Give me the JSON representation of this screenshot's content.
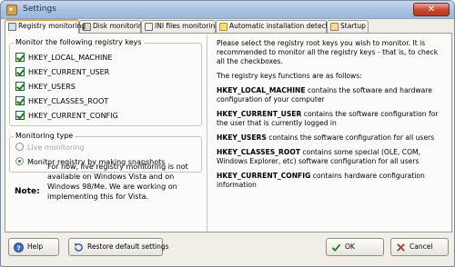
{
  "window": {
    "title": "Settings"
  },
  "tabs": [
    {
      "label": "Registry monitoring",
      "icon": "registry-icon",
      "active": true
    },
    {
      "label": "Disk monitoring",
      "icon": "disk-icon",
      "active": false
    },
    {
      "label": "INI files monitoring",
      "icon": "ini-file-icon",
      "active": false
    },
    {
      "label": "Automatic installation detection",
      "icon": "lightning-icon",
      "active": false
    },
    {
      "label": "Startup",
      "icon": "startup-icon",
      "active": false
    }
  ],
  "registry_keys": {
    "legend": "Monitor the following registry keys",
    "items": [
      {
        "label": "HKEY_LOCAL_MACHINE",
        "checked": true
      },
      {
        "label": "HKEY_CURRENT_USER",
        "checked": true
      },
      {
        "label": "HKEY_USERS",
        "checked": true
      },
      {
        "label": "HKEY_CLASSES_ROOT",
        "checked": true
      },
      {
        "label": "HKEY_CURRENT_CONFIG",
        "checked": true
      }
    ]
  },
  "monitoring_type": {
    "legend": "Monitoring type",
    "options": [
      {
        "label": "Live monitoring",
        "selected": false,
        "disabled": true
      },
      {
        "label": "Monitor registry by making snapshots",
        "selected": true,
        "disabled": false
      }
    ]
  },
  "note": {
    "label": "Note:",
    "text": "For now, live registry monitoring is not available on Windows Vista and on Windows 98/Me. We are working on implementing this for Vista."
  },
  "help_text": {
    "intro": "Please select the registry root keys you wish to monitor. It is recommended to monitor all the registry keys - that is, to check all the checkboxes.",
    "functions_intro": "The registry keys functions are as follows:",
    "entries": [
      {
        "key": "HKEY_LOCAL_MACHINE",
        "desc": " contains the software and hardware configuration of your computer"
      },
      {
        "key": "HKEY_CURRENT_USER",
        "desc": " contains the software configuration for the user that is currently logged in"
      },
      {
        "key": "HKEY_USERS",
        "desc": " contains the software configuration for all users"
      },
      {
        "key": "HKEY_CLASSES_ROOT",
        "desc": " contains some special (OLE, COM, Windows Explorer, etc) software configuration for all users"
      },
      {
        "key": "HKEY_CURRENT_CONFIG",
        "desc": " contains hardware configuration information"
      }
    ]
  },
  "buttons": {
    "help": "Help",
    "restore": "Restore default settings",
    "ok": "OK",
    "cancel": "Cancel"
  },
  "colors": {
    "accent": "#e9a23b",
    "check": "#1f7a1f",
    "cancel": "#c0392b"
  }
}
